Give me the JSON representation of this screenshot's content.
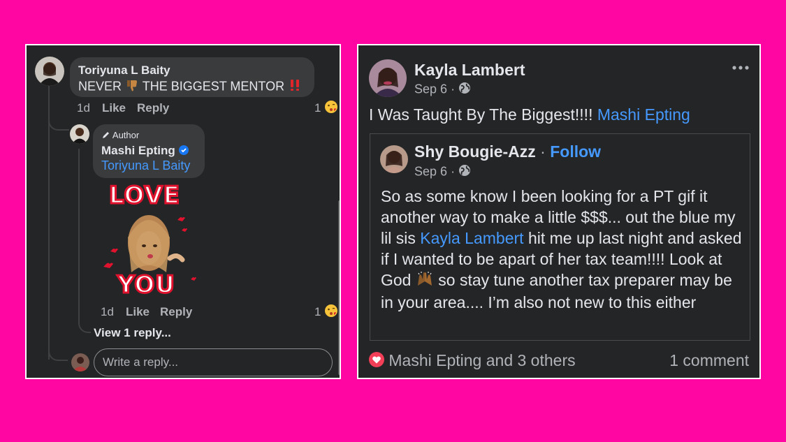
{
  "left": {
    "comment": {
      "author": "Toriyuna L Baity",
      "text_before": "NEVER",
      "text_after": "THE BIGGEST MENTOR",
      "time": "1d",
      "like_label": "Like",
      "reply_label": "Reply",
      "reaction_count": "1"
    },
    "reply": {
      "badge": "Author",
      "author": "Mashi Epting",
      "mention": "Toriyuna L Baity",
      "sticker_top": "LOVE",
      "sticker_bottom": "YOU",
      "time": "1d",
      "like_label": "Like",
      "reply_label": "Reply",
      "reaction_count": "1"
    },
    "view_replies": "View 1 reply...",
    "reply_input_placeholder": "Write a reply..."
  },
  "right": {
    "post": {
      "author": "Kayla Lambert",
      "date": "Sep 6",
      "separator": "·",
      "text": "I Was Taught By The Biggest!!!!",
      "mention": "Mashi Epting"
    },
    "shared": {
      "author": "Shy Bougie-Azz",
      "separator": "·",
      "follow_label": "Follow",
      "date": "Sep 6",
      "text_1": "So as some know I been looking for a PT gif it another way to make a little $$$... out the blue my lil sis",
      "mention": "Kayla Lambert",
      "text_2": "hit me up last night and asked if I wanted to be apart of her tax team!!!! Look at God",
      "text_3": "so stay tune another tax preparer may be in your area.... I’m also not new to this either"
    },
    "footer": {
      "reactions_text": "Mashi Epting and 3 others",
      "comments_text": "1 comment"
    }
  },
  "colors": {
    "background": "#ff06a2",
    "panel": "#242526",
    "bubble": "#3a3b3c",
    "link": "#4599ff",
    "text": "#e4e6eb",
    "muted": "#b0b3b8",
    "love_reaction": "#f33e58"
  },
  "icons": [
    "thumbs-down-icon",
    "double-exclamation-icon",
    "kissing-face-icon",
    "pencil-icon",
    "verified-badge-icon",
    "globe-icon",
    "more-options-icon",
    "raised-hands-icon",
    "heart-reaction-icon"
  ]
}
